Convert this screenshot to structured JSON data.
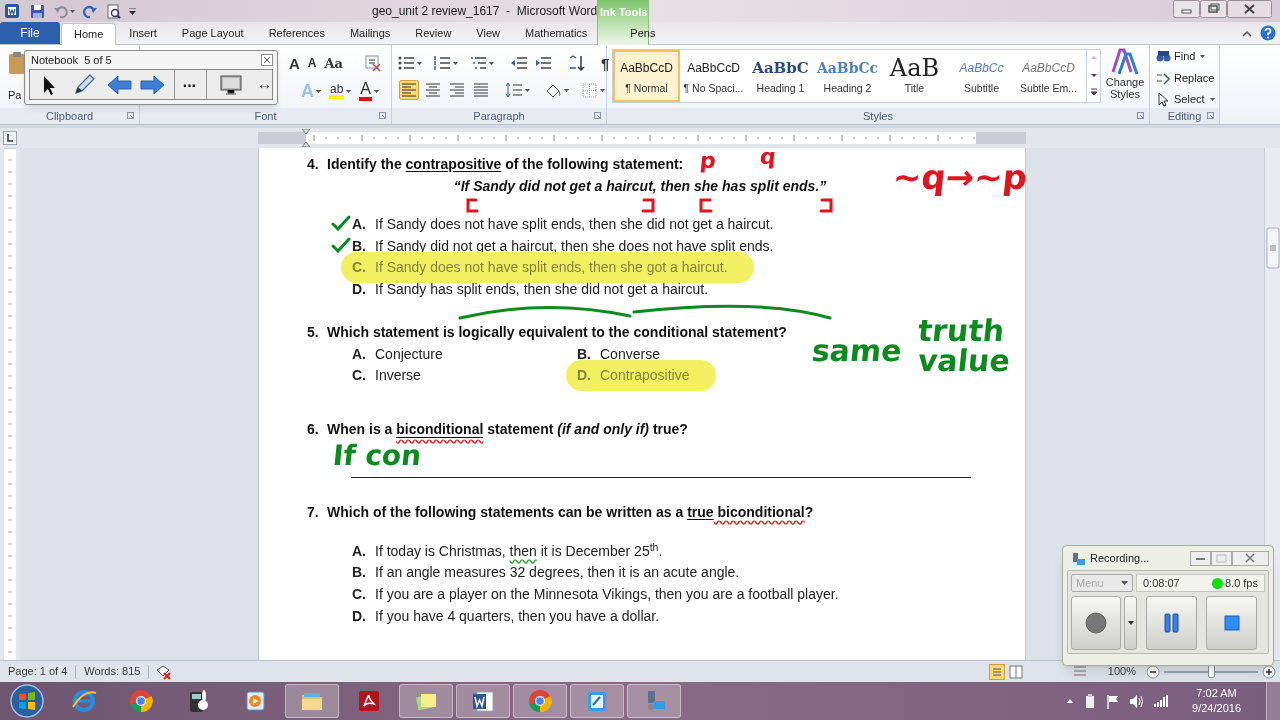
{
  "window": {
    "title": "geo_unit 2 review_1617  -  Microsoft Word"
  },
  "contextual_group": "Ink Tools",
  "tabs": [
    {
      "label": "File",
      "kind": "file",
      "selected": false
    },
    {
      "label": "Home",
      "kind": "normal",
      "selected": true
    },
    {
      "label": "Insert",
      "kind": "normal",
      "selected": false
    },
    {
      "label": "Page Layout",
      "kind": "normal",
      "selected": false
    },
    {
      "label": "References",
      "kind": "normal",
      "selected": false
    },
    {
      "label": "Mailings",
      "kind": "normal",
      "selected": false
    },
    {
      "label": "Review",
      "kind": "normal",
      "selected": false
    },
    {
      "label": "View",
      "kind": "normal",
      "selected": false
    },
    {
      "label": "Mathematics",
      "kind": "normal",
      "selected": false
    },
    {
      "label": "Pens",
      "kind": "contextual",
      "selected": false
    }
  ],
  "ribbon": {
    "clipboard": {
      "paste_label": "Pa",
      "group_label": "Clipboard"
    },
    "font": {
      "group_label": "Font",
      "row1": [
        {
          "glyph": "A",
          "kind": "grow"
        },
        {
          "glyph": "A",
          "kind": "shrink"
        },
        {
          "glyph": "Aa",
          "kind": "case"
        }
      ],
      "row2": [
        {
          "glyph": "A",
          "kind": "effects"
        },
        {
          "glyph": "ab",
          "kind": "highlight"
        },
        {
          "glyph": "A",
          "kind": "color"
        }
      ]
    },
    "paragraph": {
      "group_label": "Paragraph",
      "pilcrow": "¶",
      "alignment": [
        {
          "kind": "left",
          "selected": true
        },
        {
          "kind": "center",
          "selected": false
        },
        {
          "kind": "right",
          "selected": false
        },
        {
          "kind": "justify",
          "selected": false
        }
      ]
    },
    "styles": {
      "group_label": "Styles",
      "change_styles": "Change Styles",
      "items": [
        {
          "preview": "AaBbCcD",
          "name": "¶ Normal",
          "kind": "normal",
          "selected": true
        },
        {
          "preview": "AaBbCcD",
          "name": "¶ No Spaci...",
          "kind": "normal",
          "selected": false
        },
        {
          "preview": "AaBbC",
          "name": "Heading 1",
          "kind": "heading1",
          "selected": false
        },
        {
          "preview": "AaBbCc",
          "name": "Heading 2",
          "kind": "heading2",
          "selected": false
        },
        {
          "preview": "AaB",
          "name": "Title",
          "kind": "title",
          "selected": false
        },
        {
          "preview": "AaBbCc",
          "name": "Subtitle",
          "kind": "subtitle",
          "selected": false
        },
        {
          "preview": "AaBbCcD",
          "name": "Subtle Em...",
          "kind": "subtle",
          "selected": false
        }
      ]
    },
    "editing": {
      "group_label": "Editing",
      "find": "Find",
      "replace": "Replace",
      "select": "Select"
    }
  },
  "notebook_toolbar": {
    "title": "Notebook  5 of 5",
    "more": "...",
    "resize": "↔"
  },
  "document": {
    "questions": [
      {
        "number": "4.",
        "kind": "choice",
        "prompt": [
          {
            "text": "Identify the ",
            "kind": "plain"
          },
          {
            "text": "contrapositive",
            "kind": "underline"
          },
          {
            "text": " of the following statement:",
            "kind": "plain"
          }
        ],
        "quote": "“If Sandy did not get a haircut, then she has split ends.”",
        "options": [
          {
            "letter": "A.",
            "text": "If Sandy does not have split ends, then she did not get a haircut.",
            "crossed": true,
            "highlighted": false
          },
          {
            "letter": "B.",
            "text": "If Sandy did not get a haircut, then she does not have split ends.",
            "crossed": true,
            "highlighted": false
          },
          {
            "letter": "C.",
            "text": "If Sandy does not have split ends, then she got a haircut.",
            "crossed": false,
            "highlighted": true
          },
          {
            "letter": "D.",
            "text": "If Sandy has split ends, then she did not get a haircut.",
            "crossed": false,
            "highlighted": false
          }
        ]
      },
      {
        "number": "5.",
        "kind": "choice_grid",
        "prompt": [
          {
            "text": "Which statement is logically equivalent to the conditional statement?",
            "kind": "plain"
          }
        ],
        "options": [
          {
            "letter": "A.",
            "text": "Conjecture",
            "crossed": false,
            "highlighted": false
          },
          {
            "letter": "B.",
            "text": "Converse",
            "crossed": false,
            "highlighted": false
          },
          {
            "letter": "C.",
            "text": "Inverse",
            "crossed": false,
            "highlighted": false
          },
          {
            "letter": "D.",
            "text": "Contrapositive",
            "crossed": false,
            "highlighted": true
          }
        ]
      },
      {
        "number": "6.",
        "kind": "open",
        "prompt": [
          {
            "text": "When is a ",
            "kind": "plain"
          },
          {
            "text": "biconditional",
            "kind": "spelling_underline"
          },
          {
            "text": " statement ",
            "kind": "plain"
          },
          {
            "text": "(if and only if)",
            "kind": "italic"
          },
          {
            "text": " true?",
            "kind": "plain"
          }
        ]
      },
      {
        "number": "7.",
        "kind": "choice",
        "prompt": [
          {
            "text": "Which of the following statements can be written as a ",
            "kind": "plain"
          },
          {
            "text": "true",
            "kind": "underline"
          },
          {
            "text": " biconditional",
            "kind": "spelling"
          },
          {
            "text": "?",
            "kind": "plain"
          }
        ],
        "options": [
          {
            "letter": "A.",
            "parts": [
              {
                "text": "If today is Christmas, ",
                "kind": "plain"
              },
              {
                "text": "then",
                "kind": "grammar"
              },
              {
                "text": " it is December 25$^{th}$.",
                "kind": "plain"
              }
            ],
            "crossed": false,
            "highlighted": false
          },
          {
            "letter": "B.",
            "text": "If an angle measures 32 degrees, then it is an acute angle.",
            "crossed": false,
            "highlighted": false
          },
          {
            "letter": "C.",
            "text": "If you are a player on the Minnesota Vikings, then you are a football player.",
            "crossed": false,
            "highlighted": false
          },
          {
            "letter": "D.",
            "text": "If you have 4 quarters, then you have a dollar.",
            "crossed": false,
            "highlighted": false
          }
        ]
      }
    ]
  },
  "ink": [
    {
      "text": "p",
      "color": "#e0141e"
    },
    {
      "text": "q",
      "color": "#e0141e"
    },
    {
      "text": "~q→~p",
      "color": "#e0141e"
    },
    {
      "text": "same",
      "color": "#0c8a1f"
    },
    {
      "text": "truth",
      "color": "#0c8a1f"
    },
    {
      "text": "value",
      "color": "#0c8a1f"
    },
    {
      "text": "If con",
      "color": "#0c8a1f"
    }
  ],
  "status_bar": {
    "page": "Page: 1 of 4",
    "words": "Words: 815",
    "zoom": "100%",
    "zoom_slider": {
      "level": 0.5
    }
  },
  "recorder": {
    "title": "Recording...",
    "menu": "Menu",
    "menu_disabled": true,
    "time": "0:08:07",
    "fps": "8.0 fps",
    "active": true
  },
  "taskbar": {
    "apps": [
      {
        "kind": "ie",
        "running": false
      },
      {
        "kind": "chrome",
        "running": false
      },
      {
        "kind": "calculator",
        "running": false
      },
      {
        "kind": "media",
        "running": false
      },
      {
        "kind": "explorer",
        "running": true
      },
      {
        "kind": "acrobat",
        "running": false
      },
      {
        "kind": "sticky",
        "running": true
      },
      {
        "kind": "word",
        "running": true
      },
      {
        "kind": "chrome",
        "running": true
      },
      {
        "kind": "notepad",
        "running": true
      },
      {
        "kind": "recorder",
        "running": true
      }
    ],
    "time": "7:02 AM",
    "date": "9/24/2016"
  }
}
